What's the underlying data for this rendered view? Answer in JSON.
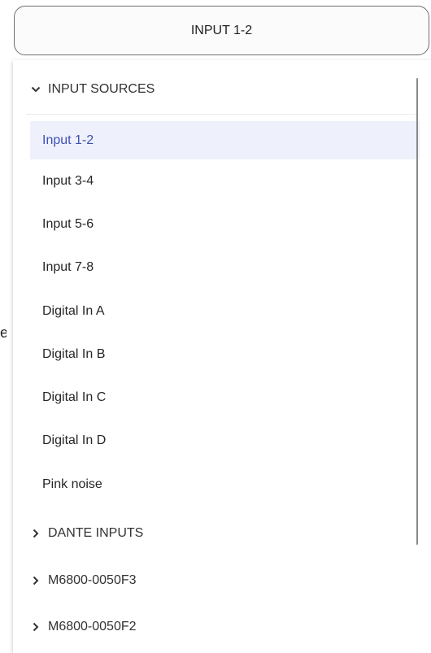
{
  "select": {
    "value": "INPUT 1-2"
  },
  "edge_text": "e",
  "dropdown": {
    "expanded_group": {
      "label": "INPUT SOURCES"
    },
    "items": [
      {
        "label": "Input 1-2",
        "selected": true
      },
      {
        "label": "Input 3-4",
        "selected": false
      },
      {
        "label": "Input 5-6",
        "selected": false
      },
      {
        "label": "Input 7-8",
        "selected": false
      },
      {
        "label": "Digital In A",
        "selected": false
      },
      {
        "label": "Digital In B",
        "selected": false
      },
      {
        "label": "Digital In C",
        "selected": false
      },
      {
        "label": "Digital In D",
        "selected": false
      },
      {
        "label": "Pink noise",
        "selected": false
      }
    ],
    "collapsed_groups": [
      {
        "label": "DANTE INPUTS"
      },
      {
        "label": "M6800-0050F3"
      },
      {
        "label": "M6800-0050F2"
      }
    ]
  },
  "colors": {
    "selected_text": "#3f51b5",
    "selected_bg": "#eef0fb"
  }
}
